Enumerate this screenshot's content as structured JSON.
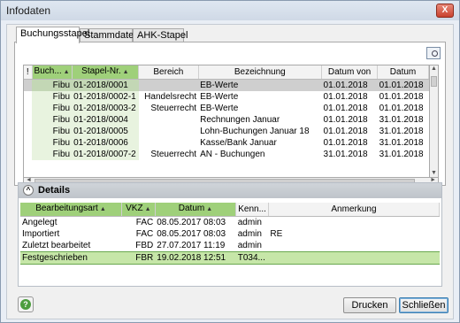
{
  "window": {
    "title": "Infodaten",
    "close_label": "X"
  },
  "tabs": [
    {
      "label": "Buchungsstapel"
    },
    {
      "label": "Stammdaten"
    },
    {
      "label": "AHK-Stapel"
    }
  ],
  "stapel_grid": {
    "headers": [
      "!",
      "Buch...",
      "Stapel-Nr.",
      "Bereich",
      "Bezeichnung",
      "Datum von",
      "Datum"
    ],
    "rows": [
      [
        "",
        "Fibu",
        "01-2018/0001",
        "",
        "EB-Werte",
        "01.01.2018",
        "01.01.2018"
      ],
      [
        "",
        "Fibu",
        "01-2018/0002-1",
        "Handelsrecht",
        "EB-Werte",
        "01.01.2018",
        "01.01.2018"
      ],
      [
        "",
        "Fibu",
        "01-2018/0003-2",
        "Steuerrecht",
        "EB-Werte",
        "01.01.2018",
        "01.01.2018"
      ],
      [
        "",
        "Fibu",
        "01-2018/0004",
        "",
        "Rechnungen Januar",
        "01.01.2018",
        "31.01.2018"
      ],
      [
        "",
        "Fibu",
        "01-2018/0005",
        "",
        "Lohn-Buchungen Januar 18",
        "01.01.2018",
        "31.01.2018"
      ],
      [
        "",
        "Fibu",
        "01-2018/0006",
        "",
        "Kasse/Bank Januar",
        "01.01.2018",
        "31.01.2018"
      ],
      [
        "",
        "Fibu",
        "01-2018/0007-2",
        "Steuerrecht",
        "AN - Buchungen",
        "31.01.2018",
        "31.01.2018"
      ]
    ]
  },
  "details": {
    "title": "Details",
    "headers": [
      "Bearbeitungsart",
      "VKZ",
      "Datum",
      "Kenn...",
      "Anmerkung"
    ],
    "rows": [
      [
        "Angelegt",
        "FAC",
        "08.05.2017 08:03",
        "admin",
        ""
      ],
      [
        "Importiert",
        "FAC",
        "08.05.2017 08:03",
        "admin",
        "RE"
      ],
      [
        "Zuletzt bearbeitet",
        "FBD",
        "27.07.2017 11:19",
        "admin",
        ""
      ],
      [
        "Festgeschrieben",
        "FBR",
        "19.02.2018 12:51",
        "T034...",
        ""
      ]
    ]
  },
  "buttons": {
    "print": "Drucken",
    "close": "Schließen"
  },
  "icons": {
    "help": "help-icon",
    "grid_tool": "grid-settings-icon"
  },
  "colors": {
    "accent_green": "#9fd07a",
    "highlight_row": "#c6e6a8"
  }
}
